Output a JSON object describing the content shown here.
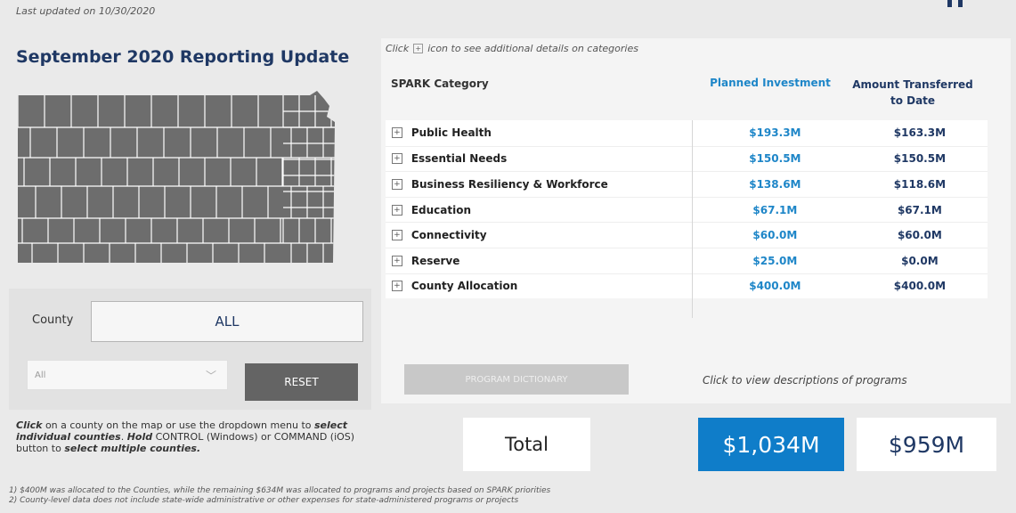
{
  "updated": "Last updated on 10/30/2020",
  "title": "September 2020 Reporting Update",
  "county_selector": {
    "label": "County",
    "value": "ALL",
    "dropdown_value": "All",
    "reset_label": "RESET"
  },
  "instructions": {
    "click": "Click",
    "t1": " on a county on the map or use the dropdown menu to ",
    "select_individual": "select individual counties",
    "t2": ". ",
    "hold": "Hold",
    "t3": " CONTROL (Windows) or COMMAND (iOS) button to ",
    "select_multiple": "select multiple counties."
  },
  "table": {
    "hint_before": "Click",
    "hint_after": "icon to see additional details on categories",
    "headers": {
      "category": "SPARK Category",
      "planned": "Planned Investment",
      "amount": "Amount Transferred to Date"
    },
    "rows": [
      {
        "category": "Public Health",
        "planned": "$193.3M",
        "amount": "$163.3M"
      },
      {
        "category": "Essential Needs",
        "planned": "$150.5M",
        "amount": "$150.5M"
      },
      {
        "category": "Business Resiliency & Workforce",
        "planned": "$138.6M",
        "amount": "$118.6M"
      },
      {
        "category": "Education",
        "planned": "$67.1M",
        "amount": "$67.1M"
      },
      {
        "category": "Connectivity",
        "planned": "$60.0M",
        "amount": "$60.0M"
      },
      {
        "category": "Reserve",
        "planned": "$25.0M",
        "amount": "$0.0M"
      },
      {
        "category": "County Allocation",
        "planned": "$400.0M",
        "amount": "$400.0M"
      }
    ]
  },
  "program_dictionary": {
    "label": "PROGRAM DICTIONARY",
    "hint": "Click to view descriptions of programs"
  },
  "totals": {
    "label": "Total",
    "planned": "$1,034M",
    "amount": "$959M"
  },
  "notes": [
    "1) $400M was allocated to the Counties, while the remaining $634M was allocated to programs and projects based on SPARK priorities",
    "2) County-level data does not include state-wide administrative or other expenses for state-administered programs or projects"
  ],
  "colors": {
    "navy": "#1f3864",
    "blue": "#1e86c8",
    "map_fill": "#6d6d6d",
    "map_line": "#ffffff"
  },
  "icons": {
    "expand": "plus-square-icon",
    "dropdown": "chevron-down-icon"
  }
}
